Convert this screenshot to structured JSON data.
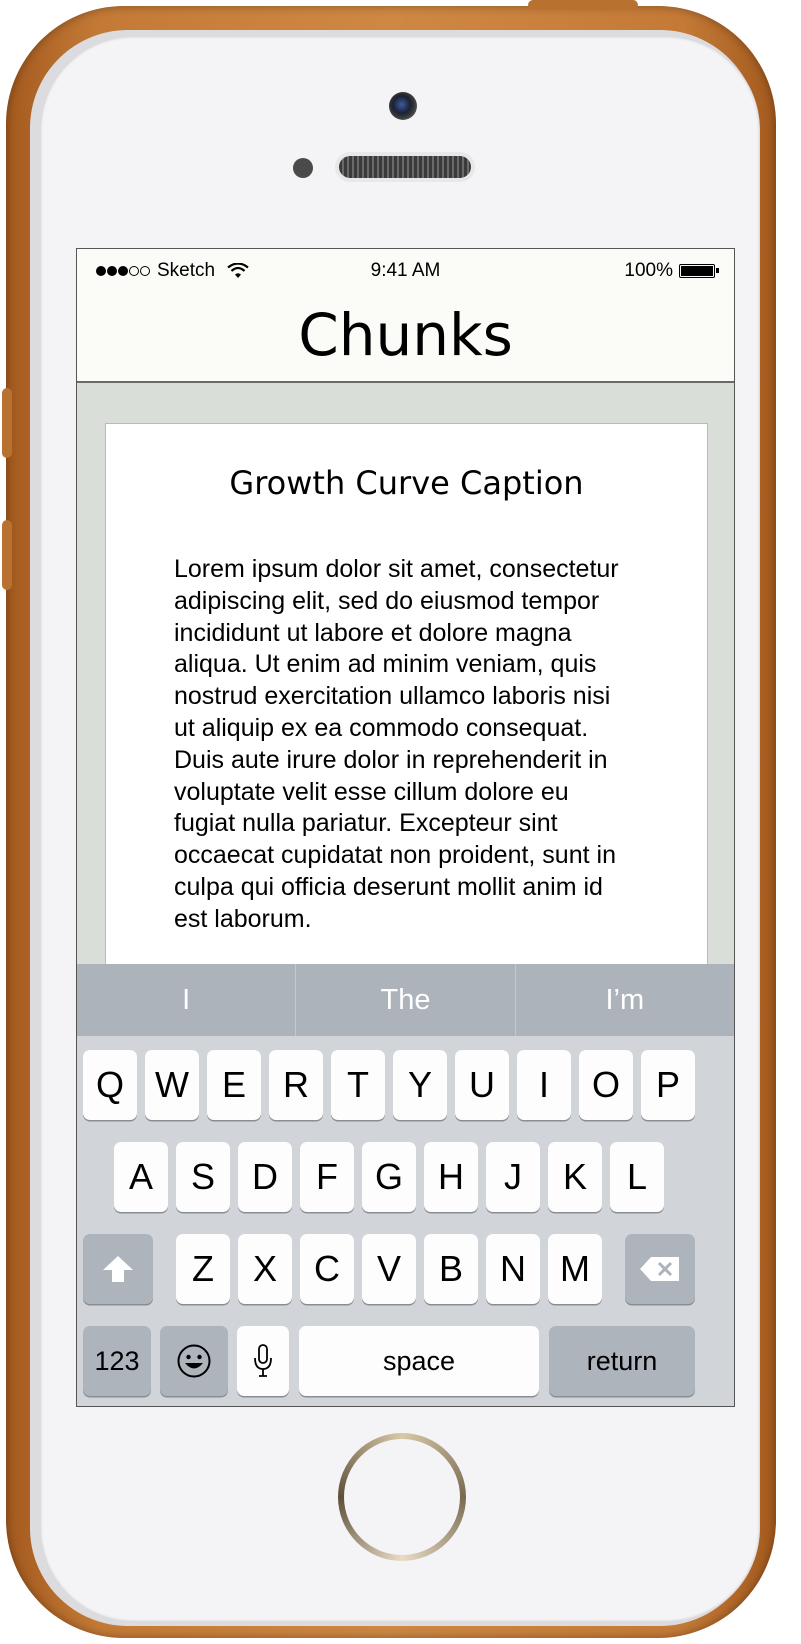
{
  "status_bar": {
    "carrier": "Sketch",
    "time": "9:41 AM",
    "battery": "100%"
  },
  "nav": {
    "title": "Chunks"
  },
  "card": {
    "title": "Growth Curve Caption",
    "body": "Lorem ipsum dolor sit amet, consectetur adipiscing elit, sed do eiusmod tempor incididunt ut labore et dolore magna aliqua. Ut enim ad minim veniam, quis nostrud exercitation ullamco laboris nisi ut aliquip ex ea commodo consequat. Duis aute irure dolor in reprehenderit in voluptate velit esse cillum dolore eu fugiat nulla pariatur. Excepteur sint occaecat cupidatat non proident, sunt in culpa qui officia deserunt mollit anim id est laborum."
  },
  "keyboard": {
    "suggestions": [
      "I",
      "The",
      "I’m"
    ],
    "row1": [
      "Q",
      "W",
      "E",
      "R",
      "T",
      "Y",
      "U",
      "I",
      "O",
      "P"
    ],
    "row2": [
      "A",
      "S",
      "D",
      "F",
      "G",
      "H",
      "J",
      "K",
      "L"
    ],
    "row3": [
      "Z",
      "X",
      "C",
      "V",
      "B",
      "N",
      "M"
    ],
    "numbers_key": "123",
    "space_key": "space",
    "return_key": "return"
  },
  "colors": {
    "case": "#c47a36",
    "nav_background": "#fbfbf8",
    "content_background": "#d9ded8",
    "keyboard_background": "#d1d5da",
    "suggestion_bar": "#acb3bb"
  }
}
